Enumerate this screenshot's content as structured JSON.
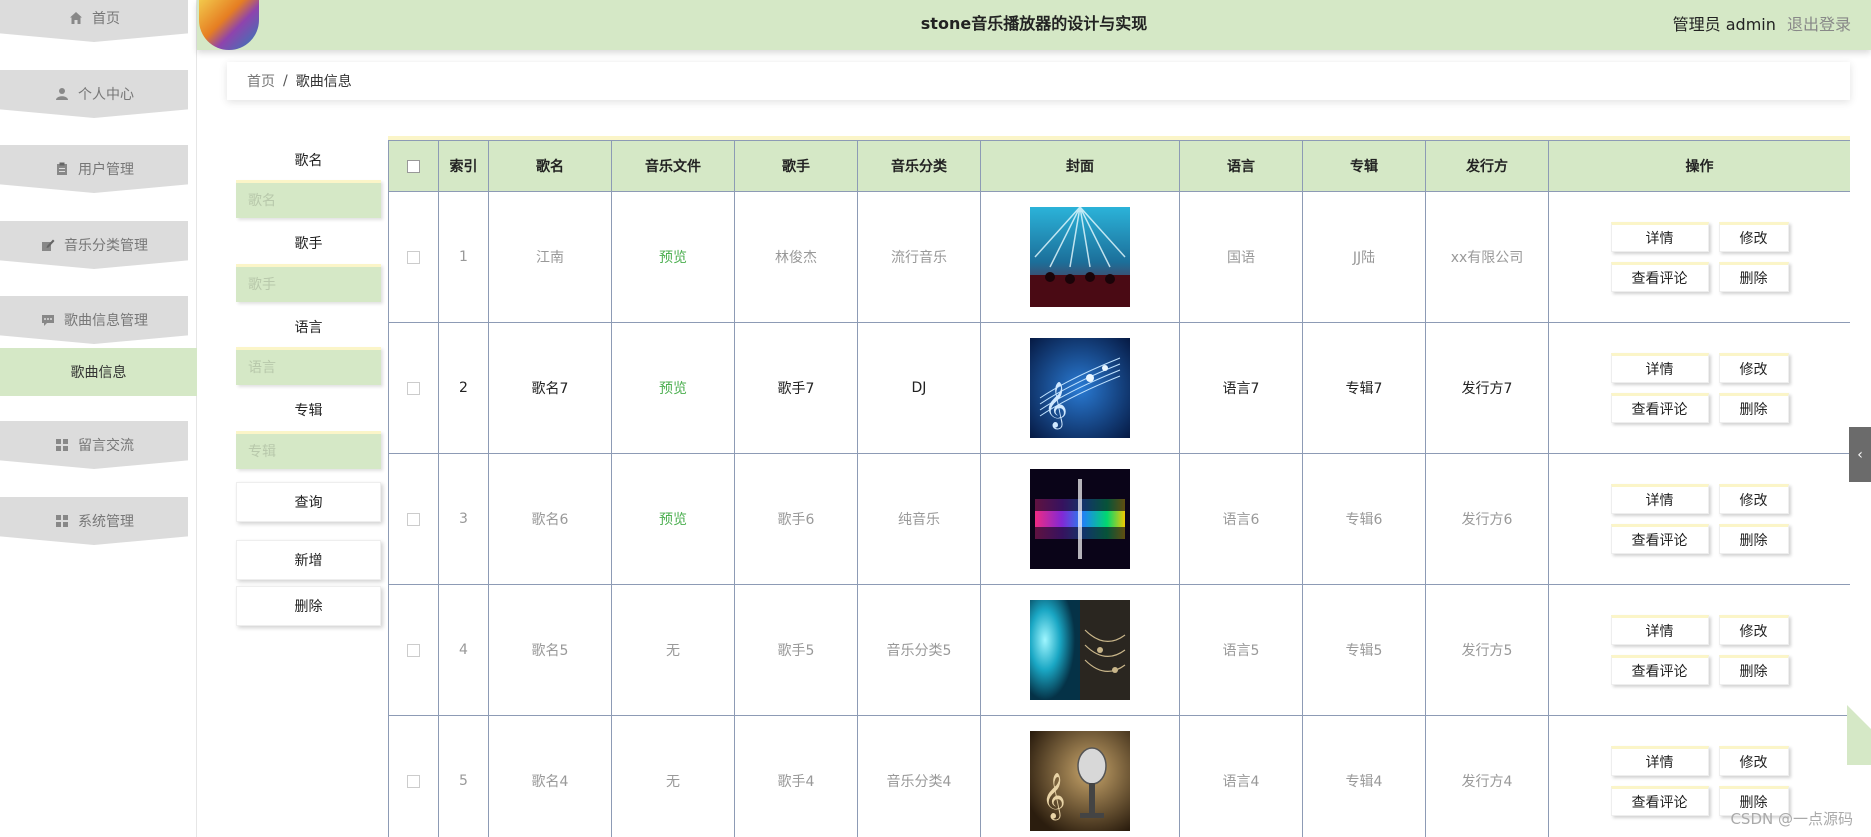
{
  "app": {
    "title": "stone音乐播放器的设计与实现",
    "user_label": "管理员 admin",
    "logout": "退出登录"
  },
  "sidebar": {
    "items": [
      {
        "label": "首页",
        "icon": "home-icon"
      },
      {
        "label": "个人中心",
        "icon": "user-icon"
      },
      {
        "label": "用户管理",
        "icon": "clipboard-icon"
      },
      {
        "label": "音乐分类管理",
        "icon": "edit-icon"
      },
      {
        "label": "歌曲信息管理",
        "icon": "message-icon"
      },
      {
        "label": "歌曲信息",
        "icon": "",
        "active": true
      },
      {
        "label": "留言交流",
        "icon": "grid-icon"
      },
      {
        "label": "系统管理",
        "icon": "grid-icon"
      }
    ]
  },
  "breadcrumb": {
    "home": "首页",
    "separator": "/",
    "current": "歌曲信息"
  },
  "search": {
    "fields": [
      {
        "label": "歌名",
        "placeholder": "歌名"
      },
      {
        "label": "歌手",
        "placeholder": "歌手"
      },
      {
        "label": "语言",
        "placeholder": "语言"
      },
      {
        "label": "专辑",
        "placeholder": "专辑"
      }
    ],
    "query_button": "查询",
    "add_button": "新增",
    "delete_button": "删除"
  },
  "table": {
    "headers": [
      "索引",
      "歌名",
      "音乐文件",
      "歌手",
      "音乐分类",
      "封面",
      "语言",
      "专辑",
      "发行方",
      "操作"
    ],
    "actions": {
      "detail": "详情",
      "edit": "修改",
      "comments": "查看评论",
      "delete": "删除"
    },
    "rows": [
      {
        "index": "1",
        "name": "江南",
        "file": "预览",
        "singer": "林俊杰",
        "category": "流行音乐",
        "language": "国语",
        "album": "JJ陆",
        "publisher": "xx有限公司"
      },
      {
        "index": "2",
        "name": "歌名7",
        "file": "预览",
        "singer": "歌手7",
        "category": "DJ",
        "language": "语言7",
        "album": "专辑7",
        "publisher": "发行方7"
      },
      {
        "index": "3",
        "name": "歌名6",
        "file": "预览",
        "singer": "歌手6",
        "category": "纯音乐",
        "language": "语言6",
        "album": "专辑6",
        "publisher": "发行方6"
      },
      {
        "index": "4",
        "name": "歌名5",
        "file": "无",
        "singer": "歌手5",
        "category": "音乐分类5",
        "language": "语言5",
        "album": "专辑5",
        "publisher": "发行方5"
      },
      {
        "index": "5",
        "name": "歌名4",
        "file": "无",
        "singer": "歌手4",
        "category": "音乐分类4",
        "language": "语言4",
        "album": "专辑4",
        "publisher": "发行方4"
      }
    ]
  },
  "watermark": "CSDN @一点源码",
  "colors": {
    "accent": "#d5e8c6",
    "preview_link": "#4caf50",
    "highlight_border": "#fbf5c8"
  }
}
